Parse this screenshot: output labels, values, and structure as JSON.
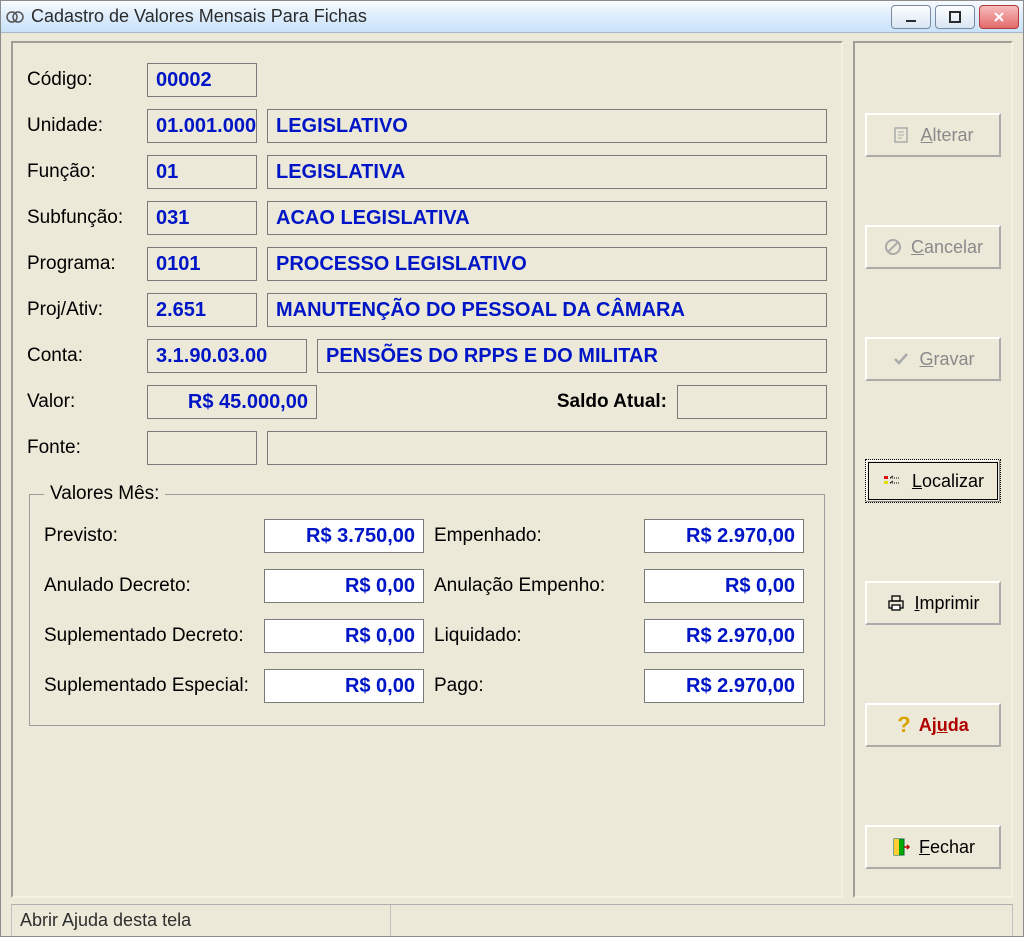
{
  "window": {
    "title": "Cadastro de Valores Mensais Para Fichas"
  },
  "labels": {
    "codigo": "Código:",
    "unidade": "Unidade:",
    "funcao": "Função:",
    "subfuncao": "Subfunção:",
    "programa": "Programa:",
    "projativ": "Proj/Ativ:",
    "conta": "Conta:",
    "valor": "Valor:",
    "saldo_atual": "Saldo Atual:",
    "fonte": "Fonte:"
  },
  "fields": {
    "codigo": "00002",
    "unidade_code": "01.001.000",
    "unidade_desc": "LEGISLATIVO",
    "funcao_code": "01",
    "funcao_desc": "LEGISLATIVA",
    "subfuncao_code": "031",
    "subfuncao_desc": "ACAO LEGISLATIVA",
    "programa_code": "0101",
    "programa_desc": "PROCESSO LEGISLATIVO",
    "projativ_code": "2.651",
    "projativ_desc": "MANUTENÇÃO DO PESSOAL DA CÂMARA",
    "conta_code": "3.1.90.03.00",
    "conta_desc": "PENSÕES DO RPPS E DO MILITAR",
    "valor": "R$ 45.000,00",
    "saldo_atual": "",
    "fonte_code": "",
    "fonte_desc": ""
  },
  "valores_mes": {
    "legend": "Valores Mês:",
    "labels": {
      "previsto": "Previsto:",
      "anulado_decreto": "Anulado Decreto:",
      "suplementado_decreto": "Suplementado Decreto:",
      "suplementado_especial": "Suplementado Especial:",
      "empenhado": "Empenhado:",
      "anulacao_empenho": "Anulação Empenho:",
      "liquidado": "Liquidado:",
      "pago": "Pago:"
    },
    "values": {
      "previsto": "R$ 3.750,00",
      "anulado_decreto": "R$ 0,00",
      "suplementado_decreto": "R$ 0,00",
      "suplementado_especial": "R$ 0,00",
      "empenhado": "R$ 2.970,00",
      "anulacao_empenho": "R$ 0,00",
      "liquidado": "R$ 2.970,00",
      "pago": "R$ 2.970,00"
    }
  },
  "buttons": {
    "alterar": "Alterar",
    "cancelar": "Cancelar",
    "gravar": "Gravar",
    "localizar": "Localizar",
    "imprimir": "Imprimir",
    "ajuda": "Ajuda",
    "fechar": "Fechar"
  },
  "statusbar": {
    "help": "Abrir Ajuda desta tela",
    "right": ""
  }
}
